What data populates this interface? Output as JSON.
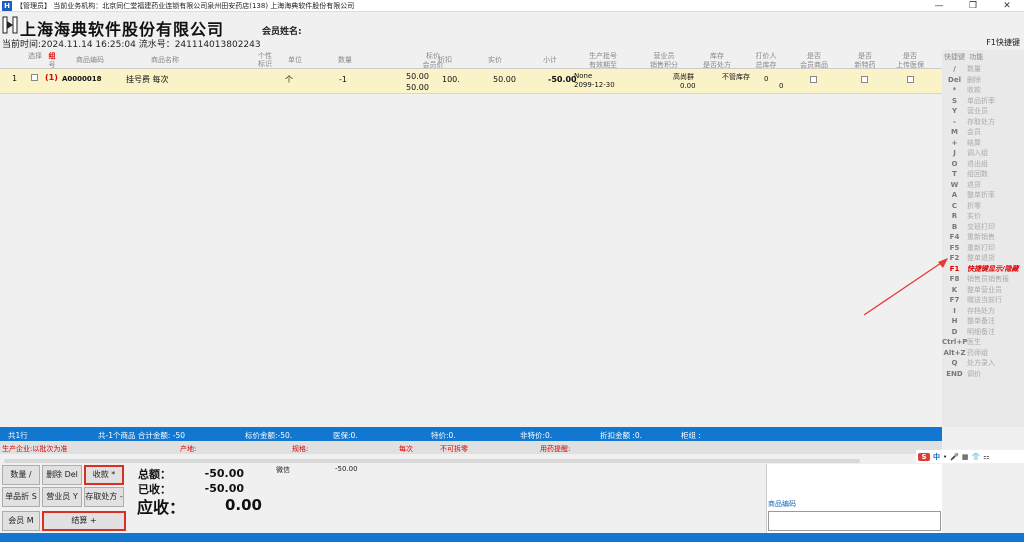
{
  "window": {
    "title": "【管理员】  当前业务机构：北京同仁堂福建药业连锁有限公司泉州田安药店(138)   上海海典软件股份有限公司",
    "controls": [
      "—",
      "❐",
      "✕"
    ]
  },
  "header": {
    "company": "上海海典软件股份有限公司",
    "member_label": "会员姓名:",
    "time_line": "当前时间:2024.11.14 16:25:04   流水号：241114013802243",
    "f1_hint": "F1快捷键"
  },
  "columns": {
    "select": "选择",
    "group": "组",
    "group_sub": "号",
    "code": "商品编码",
    "name": "商品名称",
    "discount_flag": "个性标识",
    "unit": "单位",
    "qty": "数量",
    "list_price": "标价",
    "member_price": "会员价",
    "rebate": "折扣",
    "actual_price": "实价",
    "subtotal": "小计",
    "batch": "生产批号",
    "expiry": "有效期至",
    "sales_staff": "营业员",
    "sales_points": "销售积分",
    "stock": "库存",
    "rx": "是否处方",
    "print_person": "打价人",
    "total_stock": "总库存",
    "is_member": "是否",
    "member_goods": "会员商品",
    "is_new": "是否",
    "new_goods": "新特药",
    "upload": "是否",
    "upload_medical": "上传医保"
  },
  "row": {
    "index": "1",
    "group": "(1)",
    "code": "A0000018",
    "name": "挂号费  每次",
    "unit": "个",
    "qty": "-1",
    "list_price": "50.00",
    "member_price": "50.00",
    "rebate": "100.",
    "actual_price": "50.00",
    "subtotal": "-50.00",
    "batch": "None",
    "expiry": "2099-12-30",
    "sales_staff": "高尚群",
    "sales_points": "0.00",
    "stock_status": "不管库存",
    "print_count": "0",
    "total_stock": "0"
  },
  "shortcuts": {
    "head_key": "快捷键",
    "head_func": "功能",
    "items": [
      {
        "key": "/",
        "label": "数量"
      },
      {
        "key": "Del",
        "label": "删除"
      },
      {
        "key": "*",
        "label": "收款"
      },
      {
        "key": "S",
        "label": "单品折率"
      },
      {
        "key": "Y",
        "label": "营业员"
      },
      {
        "key": "-",
        "label": "存取处方"
      },
      {
        "key": "M",
        "label": "会员"
      },
      {
        "key": "+",
        "label": "结算"
      },
      {
        "key": "J",
        "label": "调入组"
      },
      {
        "key": "O",
        "label": "退出组"
      },
      {
        "key": "T",
        "label": "组回数"
      },
      {
        "key": "W",
        "label": "退货"
      },
      {
        "key": "A",
        "label": "整单折率"
      },
      {
        "key": "C",
        "label": "折零"
      },
      {
        "key": "R",
        "label": "实价"
      },
      {
        "key": "B",
        "label": "交班打印"
      },
      {
        "key": "F4",
        "label": "重新销售"
      },
      {
        "key": "F5",
        "label": "重新打印"
      },
      {
        "key": "F2",
        "label": "整单退货"
      },
      {
        "key": "F1",
        "label": "快捷键显示/隐藏"
      },
      {
        "key": "F8",
        "label": "销售员销售报"
      },
      {
        "key": "K",
        "label": "整单营业员"
      },
      {
        "key": "F7",
        "label": "赠送当前行"
      },
      {
        "key": "I",
        "label": "存档处方"
      },
      {
        "key": "H",
        "label": "整单备注"
      },
      {
        "key": "D",
        "label": "明细备注"
      },
      {
        "key": "Ctrl+P",
        "label": "医生"
      },
      {
        "key": "Alt+Z",
        "label": "药师组"
      },
      {
        "key": "Q",
        "label": "处方录入"
      },
      {
        "key": "END",
        "label": "调价"
      }
    ]
  },
  "status": {
    "rows": "共1行",
    "summary": "共-1个商品  合计金额: -50",
    "list_amount": "标价金额:-50.",
    "insurance": "医保:0.",
    "special": "特价:0.",
    "non_special": "非特价:0.",
    "discount_amount": "折扣金额 :0.",
    "cabinet": "柜组 :"
  },
  "info": {
    "manufacturer": "生产企业:以批次为准",
    "origin": "产地:",
    "spec": "规格:",
    "each": "每次",
    "no_split": "不可拆零",
    "warning": "用药提醒:"
  },
  "buttons": {
    "qty": "数量 /",
    "delete": "删除 Del",
    "collect": "收款 *",
    "single_discount": "单品折 S",
    "sales_staff": "营业员 Y",
    "rx_store": "存取处方 -",
    "member": "会员 M",
    "settle": "结算 +"
  },
  "totals": {
    "total_label": "总额：",
    "total_value": "-50.00",
    "paid_label": "已收：",
    "paid_value": "-50.00",
    "due_label": "应收：",
    "due_value": "0.00",
    "pay_method": "微信",
    "pay_amount": "-50.00"
  },
  "code_panel": {
    "label": "商品编码"
  },
  "ime": {
    "items": [
      "S",
      "中",
      "•",
      "🎤",
      "▦",
      "👕",
      "⚏"
    ]
  },
  "colors": {
    "row_highlight": "#fbf3c8",
    "status_bar": "#1177d1",
    "alert": "#d00000"
  }
}
